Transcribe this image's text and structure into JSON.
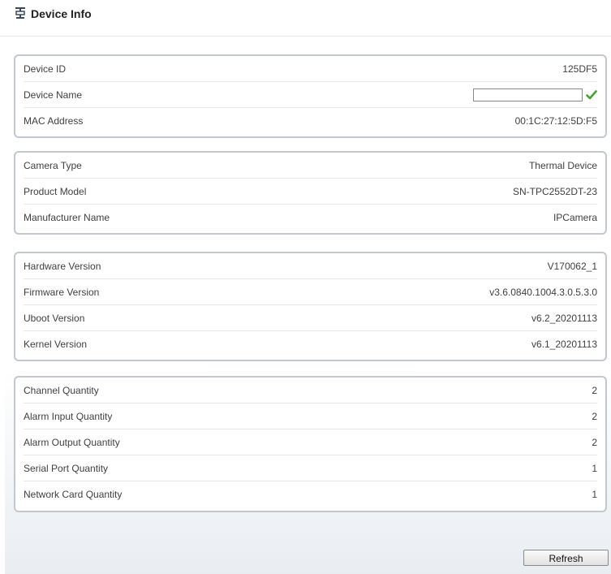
{
  "header": {
    "title": "Device Info",
    "icon": "device-info-icon"
  },
  "panels": [
    {
      "rows": [
        {
          "label": "Device ID",
          "value": "125DF5"
        },
        {
          "label": "Device Name",
          "input_value": "",
          "valid_icon": "checkmark-icon"
        },
        {
          "label": "MAC Address",
          "value": "00:1C:27:12:5D:F5"
        }
      ]
    },
    {
      "rows": [
        {
          "label": "Camera Type",
          "value": "Thermal Device"
        },
        {
          "label": "Product Model",
          "value": "SN-TPC2552DT-23"
        },
        {
          "label": "Manufacturer Name",
          "value": "IPCamera"
        }
      ]
    },
    {
      "rows": [
        {
          "label": "Hardware Version",
          "value": "V170062_1"
        },
        {
          "label": "Firmware Version",
          "value": "v3.6.0840.1004.3.0.5.3.0"
        },
        {
          "label": "Uboot Version",
          "value": "v6.2_20201113"
        },
        {
          "label": "Kernel Version",
          "value": "v6.1_20201113"
        }
      ]
    },
    {
      "rows": [
        {
          "label": "Channel Quantity",
          "value": "2"
        },
        {
          "label": "Alarm Input Quantity",
          "value": "2"
        },
        {
          "label": "Alarm Output Quantity",
          "value": "2"
        },
        {
          "label": "Serial Port Quantity",
          "value": "1"
        },
        {
          "label": "Network Card Quantity",
          "value": "1"
        }
      ]
    }
  ],
  "actions": {
    "refresh_label": "Refresh"
  },
  "colors": {
    "panel_border": "#c3c8cf",
    "check_green": "#4aa02c"
  }
}
